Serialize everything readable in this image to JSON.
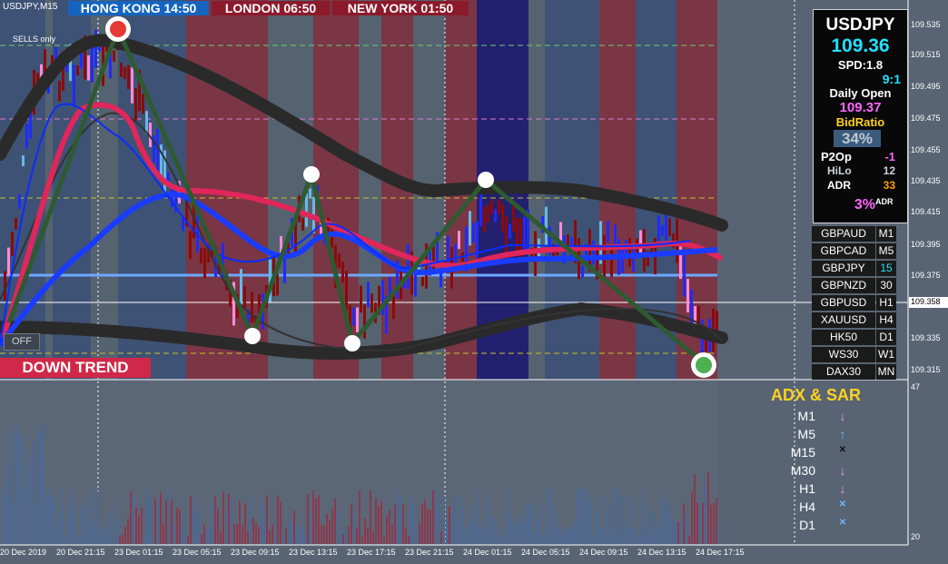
{
  "symbol_label": "USDJPY,M15",
  "sessions": [
    {
      "name": "HONG KONG",
      "time": "14:50",
      "label": "HONG KONG  14:50",
      "color": "#1565c0"
    },
    {
      "name": "LONDON",
      "time": "06:50",
      "label": "LONDON  06:50",
      "color": "#8b1a2b"
    },
    {
      "name": "NEW YORK",
      "time": "01:50",
      "label": "NEW YORK  01:50",
      "color": "#8b1a2b"
    }
  ],
  "sells_only_label": "SELLS only",
  "off_button": "OFF",
  "trend_label": "DOWN TREND",
  "price_axis": [
    "109.535",
    "109.515",
    "109.495",
    "109.475",
    "109.455",
    "109.435",
    "109.415",
    "109.395",
    "109.375",
    "109.335",
    "109.315"
  ],
  "current_price_tag": "109.358",
  "time_axis": [
    "20 Dec 2019",
    "20 Dec 21:15",
    "23 Dec 01:15",
    "23 Dec 05:15",
    "23 Dec 09:15",
    "23 Dec 13:15",
    "23 Dec 17:15",
    "23 Dec 21:15",
    "24 Dec 01:15",
    "24 Dec 05:15",
    "24 Dec 09:15",
    "24 Dec 13:15",
    "24 Dec 17:15"
  ],
  "sub_axis": {
    "top": "47",
    "bottom": "20"
  },
  "info_panel": {
    "symbol": "USDJPY",
    "price": "109.36",
    "spread": "SPD:1.8",
    "ratio": "9:1",
    "daily_open_label": "Daily Open",
    "daily_open": "109.37",
    "bid_ratio_label": "BidRatio",
    "bid_ratio": "34%",
    "p2o_label": "P2Op",
    "p2o": "-1",
    "hilo_label": "HiLo",
    "hilo": "12",
    "adr_label": "ADR",
    "adr": "33",
    "adr_pct": "3%",
    "adr_suffix": "ADR"
  },
  "pairs": [
    {
      "name": "GBPAUD",
      "tf": "M1"
    },
    {
      "name": "GBPCAD",
      "tf": "M5"
    },
    {
      "name": "GBPJPY",
      "tf": "15"
    },
    {
      "name": "GBPNZD",
      "tf": "30"
    },
    {
      "name": "GBPUSD",
      "tf": "H1"
    },
    {
      "name": "XAUUSD",
      "tf": "H4"
    },
    {
      "name": "HK50",
      "tf": "D1"
    },
    {
      "name": "WS30",
      "tf": "W1"
    },
    {
      "name": "DAX30",
      "tf": "MN"
    }
  ],
  "adx_title": "ADX & SAR",
  "adx_rows": [
    {
      "tf": "M1",
      "icon": "arrow-down-icon",
      "glyph": "↓",
      "color": "#ff88ff"
    },
    {
      "tf": "M5",
      "icon": "arrow-up-icon",
      "glyph": "↑",
      "color": "#6fb7ff"
    },
    {
      "tf": "M15",
      "icon": "cross-icon",
      "glyph": "✕",
      "color": "#111111"
    },
    {
      "tf": "M30",
      "icon": "arrow-down-icon",
      "glyph": "↓",
      "color": "#ff88ff"
    },
    {
      "tf": "H1",
      "icon": "arrow-down-icon",
      "glyph": "↓",
      "color": "#ff88ff"
    },
    {
      "tf": "H4",
      "icon": "cross-icon",
      "glyph": "✕",
      "color": "#6fb7ff"
    },
    {
      "tf": "D1",
      "icon": "cross-icon",
      "glyph": "✕",
      "color": "#6fb7ff"
    }
  ],
  "colors": {
    "bull": "#1f2bff",
    "bear": "#8a0b0b",
    "ma_fast": "#1a3cff",
    "ma_slow": "#e0265a",
    "zigzag": "#2d5a30"
  }
}
